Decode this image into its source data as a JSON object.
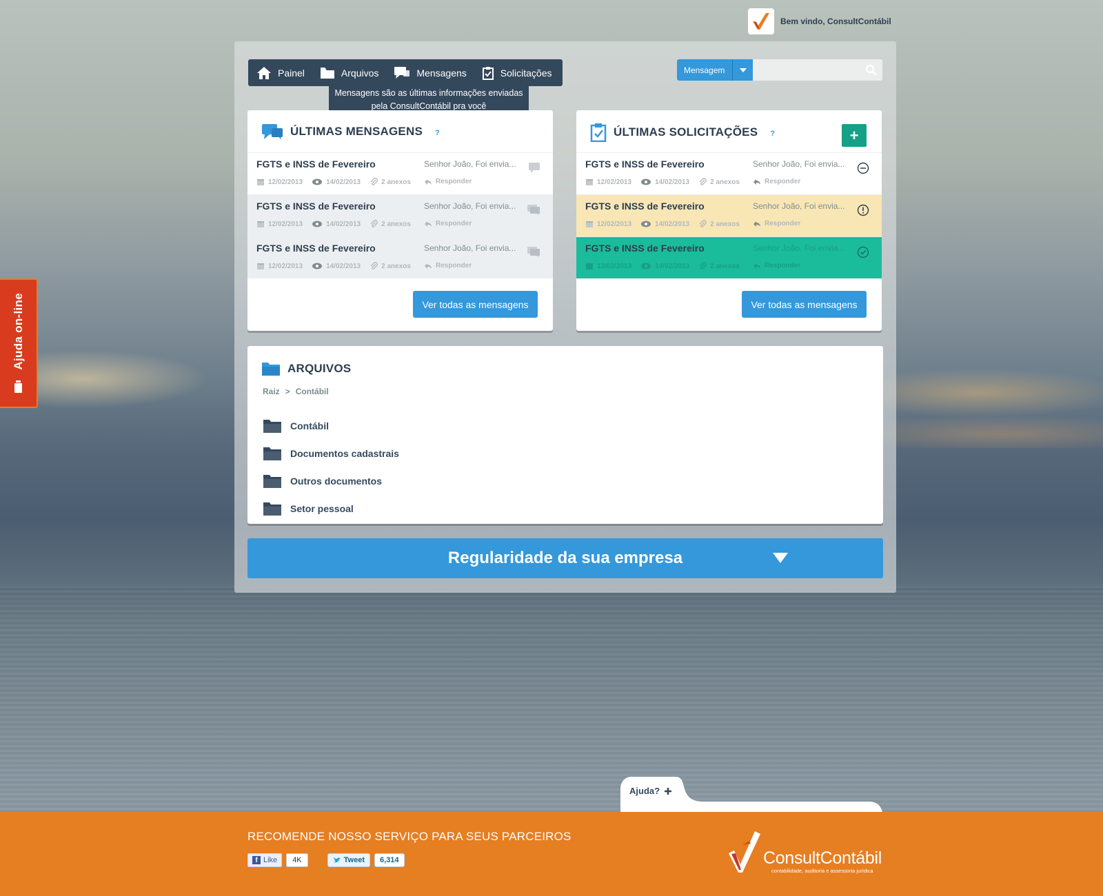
{
  "header": {
    "welcome": "Bem vindo, ConsultContábil"
  },
  "nav": {
    "items": [
      {
        "label": "Painel",
        "icon": "home-icon"
      },
      {
        "label": "Arquivos",
        "icon": "folder-icon"
      },
      {
        "label": "Mensagens",
        "icon": "chat-icon"
      },
      {
        "label": "Solicitações",
        "icon": "clipboard-check-icon"
      }
    ],
    "tooltip_line1": "Mensagens são as últimas informações enviadas",
    "tooltip_line2": "pela ConsultContábil pra você"
  },
  "search": {
    "scope": "Mensagem",
    "placeholder": ""
  },
  "messages": {
    "title": "ÚLTIMAS MENSAGENS",
    "help": "?",
    "rows": [
      {
        "title": "FGTS  e INSS de Fevereiro",
        "preview": "Senhor João, Foi envia...",
        "date_sent": "12/02/2013",
        "date_seen": "14/02/2013",
        "attachments": "2 anexos",
        "reply": "Responder"
      },
      {
        "title": "FGTS  e INSS de Fevereiro",
        "preview": "Senhor João, Foi envia...",
        "date_sent": "12/02/2013",
        "date_seen": "14/02/2013",
        "attachments": "2 anexos",
        "reply": "Responder"
      },
      {
        "title": "FGTS  e INSS de Fevereiro",
        "preview": "Senhor João, Foi envia...",
        "date_sent": "12/02/2013",
        "date_seen": "14/02/2013",
        "attachments": "2 anexos",
        "reply": "Responder"
      }
    ],
    "button": "Ver todas as mensagens"
  },
  "requests": {
    "title": "ÚLTIMAS SOLICITAÇÕES",
    "help": "?",
    "add": "+",
    "rows": [
      {
        "title": "FGTS  e INSS de Fevereiro",
        "preview": "Senhor João, Foi envia...",
        "date_sent": "12/02/2013",
        "date_seen": "14/02/2013",
        "attachments": "2 anexos",
        "reply": "Responder",
        "status": "pending"
      },
      {
        "title": "FGTS  e INSS de Fevereiro",
        "preview": "Senhor João, Foi envia...",
        "date_sent": "12/02/2013",
        "date_seen": "14/02/2013",
        "attachments": "2 anexos",
        "reply": "Responder",
        "status": "attention"
      },
      {
        "title": "FGTS  e INSS de Fevereiro",
        "preview": "Senhor João, Foi envia...",
        "date_sent": "12/02/2013",
        "date_seen": "14/02/2013",
        "attachments": "2 anexos",
        "reply": "Responder",
        "status": "done"
      }
    ],
    "button": "Ver todas as mensagens"
  },
  "files": {
    "title": "ARQUIVOS",
    "breadcrumb": {
      "root": "Raiz",
      "separator": ">",
      "current": "Contábil"
    },
    "folders": [
      "Contábil",
      "Documentos cadastrais",
      "Outros documentos",
      "Setor pessoal"
    ]
  },
  "regularity": {
    "label": "Regularidade da sua empresa"
  },
  "side_help": {
    "label": "Ajuda on-line"
  },
  "bottom_help": {
    "label": "Ajuda?"
  },
  "footer": {
    "title": "RECOMENDE NOSSO SERVIÇO PARA SEUS PARCEIROS",
    "like_label": "Like",
    "like_count": "4K",
    "tweet_label": "Tweet",
    "tweet_count": "6,314",
    "brand_name": "ConsultContábil",
    "brand_tagline": "contabilidade, auditoria e assessoria jurídica"
  },
  "colors": {
    "nav": "#34485c",
    "accent_blue": "#3498db",
    "accent_green": "#16a085",
    "row_green": "#1abc9c",
    "row_yellow": "#f8e6b5",
    "footer_orange": "#e67e22",
    "help_tab_red": "#d93b1e"
  }
}
